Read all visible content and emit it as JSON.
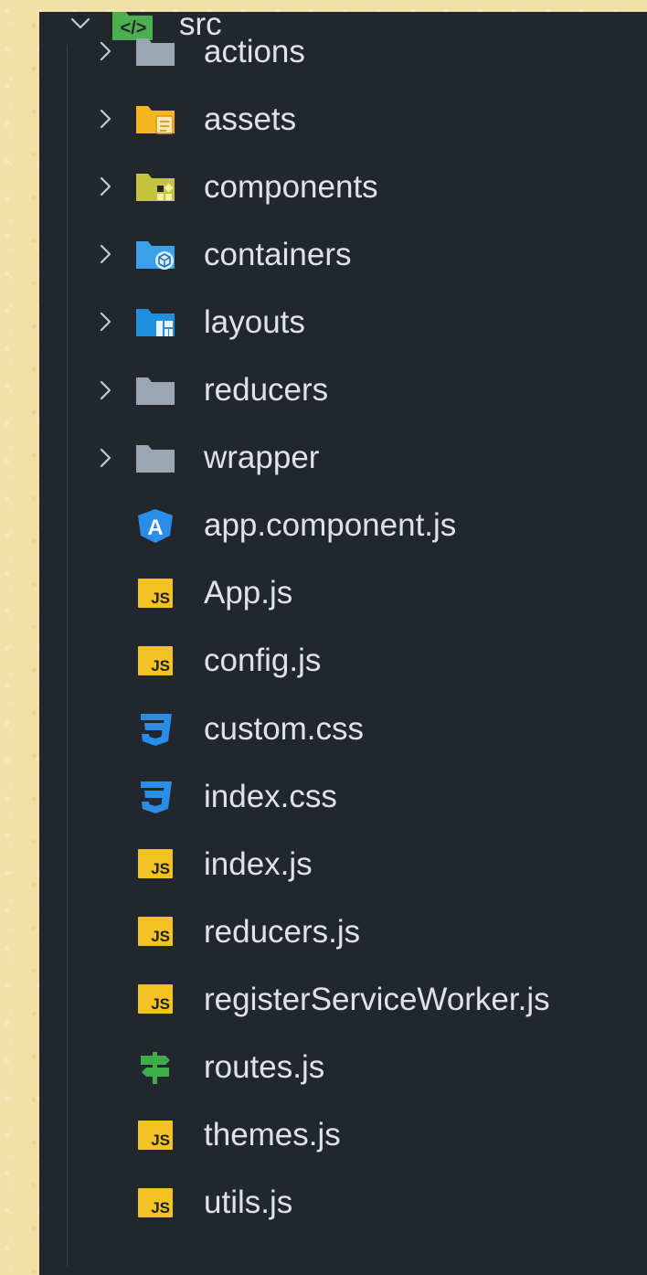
{
  "explorer": {
    "root": {
      "label": "src",
      "icon": "folder-src-code-icon",
      "expanded": true
    },
    "items": [
      {
        "label": "actions",
        "kind": "folder",
        "icon": "folder-icon",
        "color": "#9ba6b3"
      },
      {
        "label": "assets",
        "kind": "folder",
        "icon": "folder-assets-icon",
        "color": "#f5b521"
      },
      {
        "label": "components",
        "kind": "folder",
        "icon": "folder-components-icon",
        "color": "#c4c43c"
      },
      {
        "label": "containers",
        "kind": "folder",
        "icon": "folder-containers-icon",
        "color": "#3aa0e8"
      },
      {
        "label": "layouts",
        "kind": "folder",
        "icon": "folder-layouts-icon",
        "color": "#1e90e0"
      },
      {
        "label": "reducers",
        "kind": "folder",
        "icon": "folder-icon",
        "color": "#9ba6b3"
      },
      {
        "label": "wrapper",
        "kind": "folder",
        "icon": "folder-icon",
        "color": "#9ba6b3"
      },
      {
        "label": "app.component.js",
        "kind": "file",
        "icon": "angular-icon",
        "color": "#2a8ee6"
      },
      {
        "label": "App.js",
        "kind": "file",
        "icon": "javascript-icon",
        "color": "#f3c323"
      },
      {
        "label": "config.js",
        "kind": "file",
        "icon": "javascript-icon",
        "color": "#f3c323"
      },
      {
        "label": "custom.css",
        "kind": "file",
        "icon": "css3-icon",
        "color": "#2a8ee6"
      },
      {
        "label": "index.css",
        "kind": "file",
        "icon": "css3-icon",
        "color": "#2a8ee6"
      },
      {
        "label": "index.js",
        "kind": "file",
        "icon": "javascript-icon",
        "color": "#f3c323"
      },
      {
        "label": "reducers.js",
        "kind": "file",
        "icon": "javascript-icon",
        "color": "#f3c323"
      },
      {
        "label": "registerServiceWorker.js",
        "kind": "file",
        "icon": "javascript-icon",
        "color": "#f3c323"
      },
      {
        "label": "routes.js",
        "kind": "file",
        "icon": "routes-signpost-icon",
        "color": "#3fae49"
      },
      {
        "label": "themes.js",
        "kind": "file",
        "icon": "javascript-icon",
        "color": "#f3c323"
      },
      {
        "label": "utils.js",
        "kind": "file",
        "icon": "javascript-icon",
        "color": "#f3c323"
      }
    ],
    "js_badge_text": "JS"
  }
}
